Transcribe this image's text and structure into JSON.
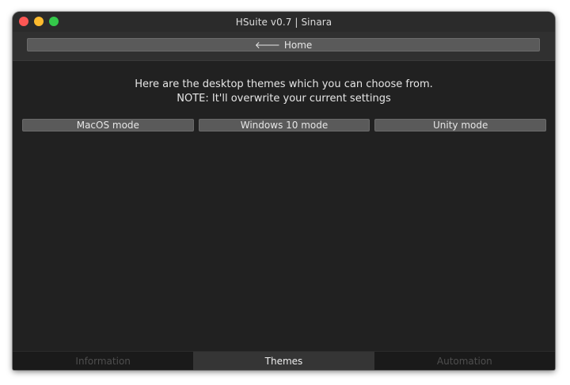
{
  "window": {
    "title": "HSuite v0.7 | Sinara"
  },
  "nav": {
    "home_label": "Home",
    "home_icon": "arrow-left-icon"
  },
  "themes_page": {
    "line1": "Here are the desktop themes which you can choose from.",
    "line2": "NOTE: It'll overwrite your current settings",
    "buttons": [
      {
        "label": "MacOS mode"
      },
      {
        "label": "Windows 10 mode"
      },
      {
        "label": "Unity mode"
      }
    ]
  },
  "tabs": [
    {
      "label": "Information",
      "active": false
    },
    {
      "label": "Themes",
      "active": true
    },
    {
      "label": "Automation",
      "active": false
    }
  ],
  "colors": {
    "close": "#fd5754",
    "minimize": "#fdbb2e",
    "maximize": "#34c84a",
    "background": "#212121"
  }
}
